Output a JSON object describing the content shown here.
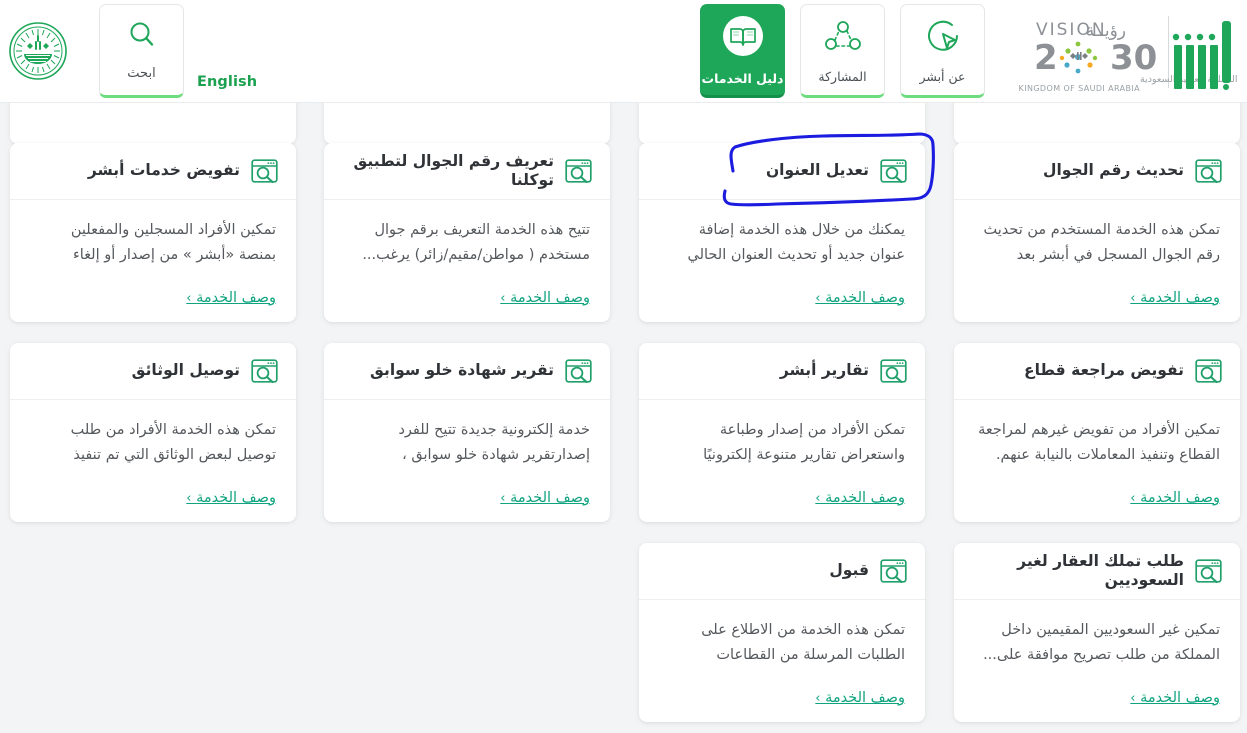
{
  "header": {
    "emblem_icon": "saudi-national-emblem",
    "search": {
      "icon": "search-icon",
      "label": "ابحث"
    },
    "english_link": "English",
    "nav": [
      {
        "id": "services-guide",
        "icon": "open-book-icon",
        "label": "دليل الخدمات",
        "active": true
      },
      {
        "id": "participation",
        "icon": "share-nodes-icon",
        "label": "المشاركة",
        "active": false
      },
      {
        "id": "about-absher",
        "icon": "cursor-circle-icon",
        "label": "عن أبشر",
        "active": false
      }
    ],
    "vision_logo": {
      "word_ar": "رؤيــــة",
      "word_en": "VISION",
      "year": "2030",
      "kingdom_ar": "المملكة العربية السعودية",
      "kingdom_en": "KINGDOM OF SAUDI ARABIA",
      "absher_wordmark": "أبشر"
    }
  },
  "colors": {
    "brand_green": "#1ea659",
    "link_green": "#10a37f",
    "accent_light_green": "#6ddc7e",
    "annotation_blue": "#1c1ce0",
    "page_bg": "#f3f4f5"
  },
  "grid": {
    "link_label": "وصف الخدمة",
    "link_chevron": "›",
    "card_icon": "browser-search-icon",
    "partial_row": [
      {
        "id": "partial-1"
      },
      {
        "id": "partial-2"
      },
      {
        "id": "partial-3"
      },
      {
        "id": "partial-4"
      }
    ],
    "cards": [
      {
        "id": "tafweed-khadamat-absher",
        "title": "تفويض خدمات أبشر",
        "desc": "تمكين الأفراد المسجلين والمفعلين بمنصة «أبشر » من إصدار أو إلغاء تفويض...",
        "row": 1,
        "col": 1,
        "highlighted": false
      },
      {
        "id": "taareef-raqm-aljawal",
        "title": "تعريف رقم الجوال لتطبيق توكلنا",
        "desc": "تتيح هذه الخدمة التعريف برقم جوال مستخدم ( مواطن/مقيم/زائر) يرغب...",
        "row": 1,
        "col": 2,
        "highlighted": false
      },
      {
        "id": "taadeel-alunwan",
        "title": "تعديل العنوان",
        "desc": "يمكنك من خلال هذه الخدمة إضافة عنوان جديد أو تحديث العنوان الحالي ليتم...",
        "row": 1,
        "col": 3,
        "highlighted": true
      },
      {
        "id": "tahdeeth-raqm-aljawal",
        "title": "تحديث رقم الجوال",
        "desc": "تمكن هذه الخدمة المستخدم من تحديث رقم الجوال المسجل في أبشر بعد تسجي...",
        "row": 1,
        "col": 4,
        "highlighted": false
      },
      {
        "id": "tawseel-alwathaeq",
        "title": "توصيل الوثائق",
        "desc": "تمكن هذه الخدمة الأفراد من طلب توصيل لبعض الوثائق التي تم تنفيذ عمليات...",
        "row": 2,
        "col": 1,
        "highlighted": false
      },
      {
        "id": "taqreer-shahadat-khuluw-sawabiq",
        "title": "تقرير شهادة خلو سوابق",
        "desc": "خدمة إلكترونية جديدة تتيح للفرد إصدارتقرير شهادة خلو سوابق ، فبإمكان...",
        "row": 2,
        "col": 2,
        "highlighted": false
      },
      {
        "id": "taqareer-absher",
        "title": "تقارير أبشر",
        "desc": "تمكن الأفراد من إصدار وطباعة واستعراض تقارير متنوعة إلكترونيًا وعرضها للجهات...",
        "row": 2,
        "col": 3,
        "highlighted": false
      },
      {
        "id": "tafweed-murajaat-qitaa",
        "title": "تفويض مراجعة قطاع",
        "desc": "تمكين الأفراد من تفويض غيرهم لمراجعة القطاع وتنفيذ المعاملات بالنيابة عنهم.",
        "row": 2,
        "col": 4,
        "highlighted": false
      },
      {
        "id": "qabool",
        "title": "قبول",
        "desc": "تمكن هذه الخدمة من الاطلاع على الطلبات المرسلة من القطاعات المشترك...",
        "row": 3,
        "col": 3,
        "highlighted": false
      },
      {
        "id": "talab-tamalluk-aqar",
        "title": "طلب تملك العقار لغير السعوديين",
        "desc": "تمكين غير السعوديين المقيمين داخل المملكة من طلب تصريح موافقة على...",
        "row": 3,
        "col": 4,
        "highlighted": false
      }
    ]
  }
}
